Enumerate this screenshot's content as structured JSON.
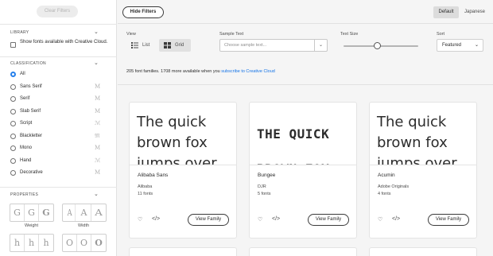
{
  "sidebar": {
    "clear_filters": "Clear Filters",
    "library": {
      "heading": "LIBRARY",
      "checkbox_label": "Show fonts available with Creative Cloud."
    },
    "classification": {
      "heading": "CLASSIFICATION",
      "items": [
        {
          "label": "All",
          "glyph": "",
          "selected": true
        },
        {
          "label": "Sans Serif",
          "glyph": "M"
        },
        {
          "label": "Serif",
          "glyph": "M"
        },
        {
          "label": "Slab Serif",
          "glyph": "M"
        },
        {
          "label": "Script",
          "glyph": "ℳ"
        },
        {
          "label": "Blackletter",
          "glyph": "𝔐"
        },
        {
          "label": "Mono",
          "glyph": "M"
        },
        {
          "label": "Hand",
          "glyph": "ℳ"
        },
        {
          "label": "Decorative",
          "glyph": "M"
        }
      ]
    },
    "properties": {
      "heading": "PROPERTIES",
      "weight_label": "Weight",
      "width_label": "Width",
      "weight_glyphs": [
        "G",
        "G",
        "G"
      ],
      "width_glyphs": [
        "A",
        "A",
        "A"
      ],
      "row2_left": [
        "h",
        "h",
        "h"
      ],
      "row2_right": [
        "O",
        "O",
        "O"
      ]
    }
  },
  "topbar": {
    "hide_filters": "Hide Filters",
    "language_default": "Default",
    "language_japanese": "Japanese"
  },
  "controls": {
    "view_label": "View",
    "view_list": "List",
    "view_grid": "Grid",
    "sample_text_label": "Sample Text",
    "sample_text_placeholder": "Choose sample text...",
    "text_size_label": "Text Size",
    "text_size_level": 0.45,
    "sort_label": "Sort",
    "sort_value": "Featured"
  },
  "info": {
    "text": "205 font families. 1708 more available when you ",
    "link": "subscribe to Creative Cloud"
  },
  "cards": [
    {
      "preview": "The quick brown fox jumps over",
      "name": "Alibaba Sans",
      "foundry": "Alibaba",
      "count": "11 fonts",
      "button": "View Family"
    },
    {
      "preview": "THE QUICK BROWN FOX",
      "name": "Bungee",
      "foundry": "DJR",
      "count": "5 fonts",
      "button": "View Family"
    },
    {
      "preview": "The quick brown fox jumps over the",
      "name": "Acumin",
      "foundry": "Adobe Originals",
      "count": "4 fonts",
      "button": "View Family"
    }
  ],
  "colors": {
    "accent": "#2680eb",
    "link": "#1473e6",
    "text": "#2c2c2c",
    "background": "#f5f5f5"
  },
  "icons": [
    "chevron-down-icon",
    "heart-icon",
    "code-icon",
    "list-icon",
    "grid-icon"
  ]
}
